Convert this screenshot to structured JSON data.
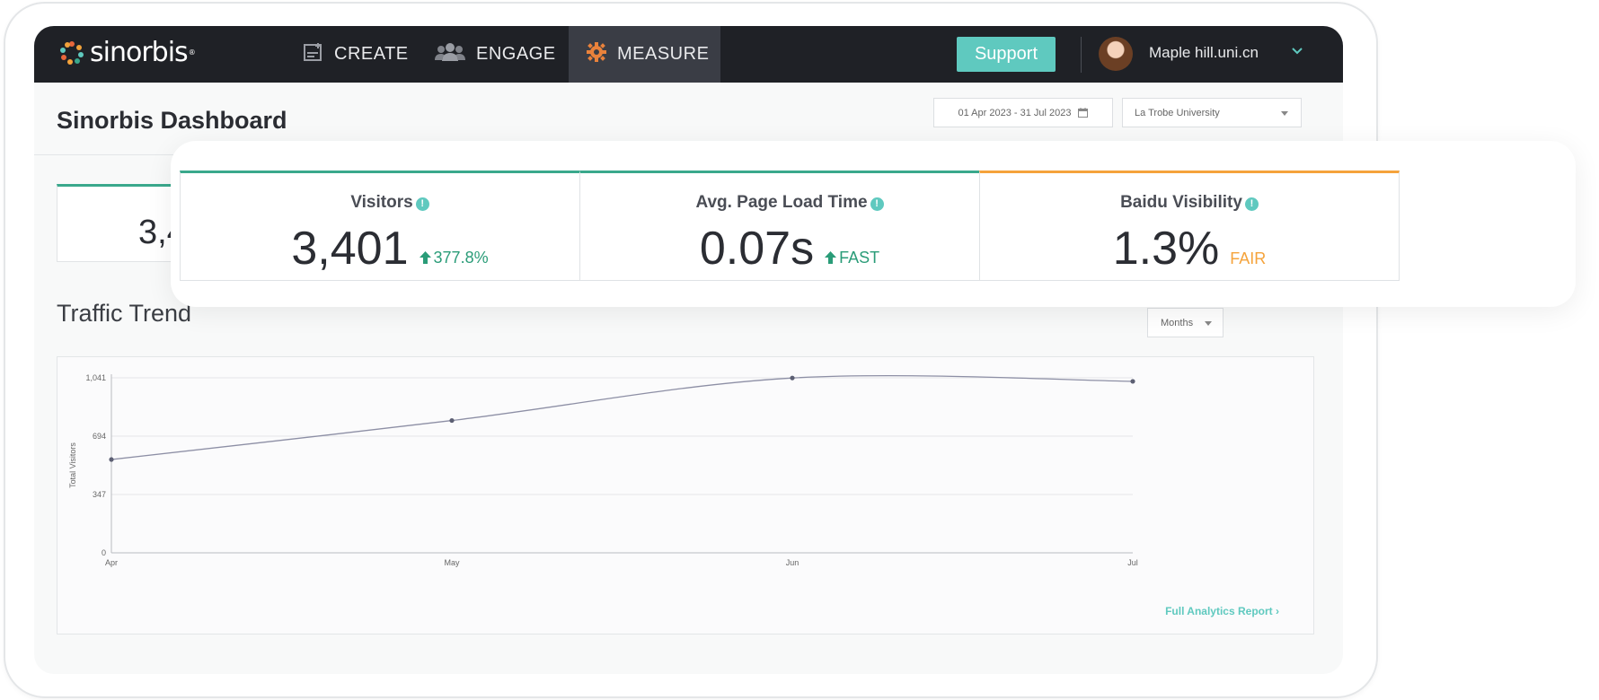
{
  "nav": {
    "logo_text": "sinorbis",
    "items": [
      {
        "label": "CREATE",
        "icon": "create-icon"
      },
      {
        "label": "ENGAGE",
        "icon": "users-icon"
      },
      {
        "label": "MEASURE",
        "icon": "gear-icon",
        "active": true
      }
    ],
    "support_label": "Support",
    "user_name": "Maple hill.uni.cn"
  },
  "header": {
    "title": "Sinorbis Dashboard",
    "date_range": "01 Apr 2023 - 31 Jul 2023",
    "university": "La Trobe University"
  },
  "ghost_card": {
    "value": "3,4"
  },
  "kpis": [
    {
      "label": "Visitors",
      "value": "3,401",
      "delta": "377.8%",
      "delta_icon": "arrow-up-icon",
      "color": "#2a9c78"
    },
    {
      "label": "Avg. Page Load Time",
      "value": "0.07s",
      "delta": "FAST",
      "delta_icon": "arrow-up-icon",
      "color": "#2a9c78"
    },
    {
      "label": "Baidu Visibility",
      "value": "1.3%",
      "delta": "FAIR",
      "delta_icon": "",
      "color": "#f5a33b"
    }
  ],
  "traffic": {
    "title": "Traffic Trend",
    "period_select": "Months",
    "report_link": "Full Analytics Report"
  },
  "chart_data": {
    "type": "line",
    "categories": [
      "Apr",
      "May",
      "Jun",
      "Jul"
    ],
    "series": [
      {
        "values": [
          555,
          787,
          1040,
          1020
        ]
      }
    ],
    "ylabel": "Total Visitors",
    "xlabel": "",
    "yticks": [
      "0",
      "347",
      "694",
      "1,041"
    ],
    "ylim": [
      0,
      1041
    ],
    "grid": true
  },
  "colors": {
    "accent": "#5fc9bf",
    "nav_bg": "#1f2126",
    "positive": "#2a9c78",
    "warning": "#f5a33b",
    "line": "#8d8fa5"
  }
}
